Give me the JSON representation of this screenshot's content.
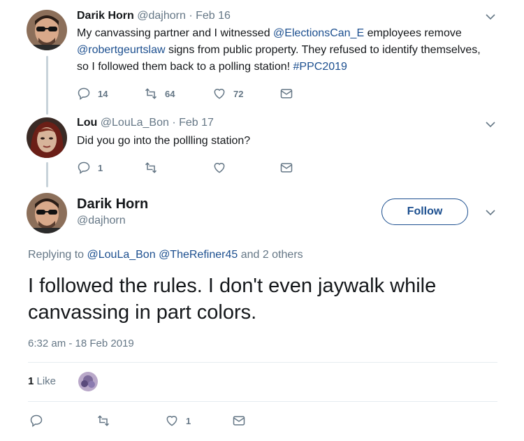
{
  "tweet1": {
    "name": "Darik Horn",
    "handle": "@dajhorn",
    "sep": "·",
    "date": "Feb 16",
    "text_parts": [
      "My canvassing partner and I witnessed ",
      "@ElectionsCan_E",
      " employees remove ",
      "@robertgeurtslaw",
      " signs from public property.  They refused to identify themselves, so I followed them back to a polling station! ",
      "#PPC2019"
    ],
    "replies": "14",
    "retweets": "64",
    "likes": "72"
  },
  "tweet2": {
    "name": "Lou",
    "handle": "@LouLa_Bon",
    "sep": "·",
    "date": "Feb 17",
    "text": "Did you go into the pollling station?",
    "replies": "1"
  },
  "main": {
    "name": "Darik Horn",
    "handle": "@dajhorn",
    "follow_label": "Follow",
    "replying_prefix": "Replying to ",
    "reply_to_1": "@LouLa_Bon",
    "reply_to_2": "@TheRefiner45",
    "replying_suffix": " and 2 others",
    "text": "I followed the rules.  I don't even jaywalk while canvassing in part colors.",
    "timestamp": "6:32 am - 18 Feb 2019",
    "likes_count": "1",
    "likes_label": " Like",
    "action_likes": "1"
  },
  "colors": {
    "link": "#1c4f8f",
    "muted": "#657786",
    "thread_line": "#c8d3da"
  }
}
